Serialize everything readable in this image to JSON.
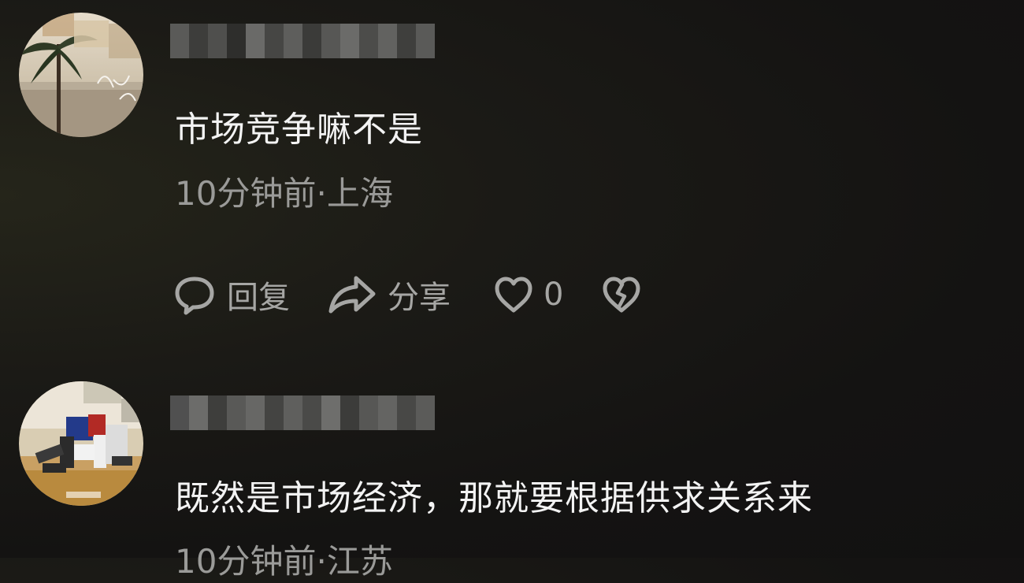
{
  "comments": [
    {
      "text": "市场竞争嘛不是",
      "time": "10分钟前",
      "separator": "·",
      "location": "上海",
      "reply_label": "回复",
      "share_label": "分享",
      "like_count": "0"
    },
    {
      "text": "既然是市场经济，那就要根据供求关系来",
      "time": "10分钟前",
      "separator": "·",
      "location": "江苏"
    }
  ],
  "icons": {
    "reply": "speech-bubble-icon",
    "share": "share-arrow-icon",
    "like": "heart-outline-icon",
    "dislike": "broken-heart-icon"
  },
  "colors": {
    "background": "#161514",
    "text_primary": "#f3f3f3",
    "text_secondary": "#9a9a98",
    "icon": "#a6a6a4"
  }
}
